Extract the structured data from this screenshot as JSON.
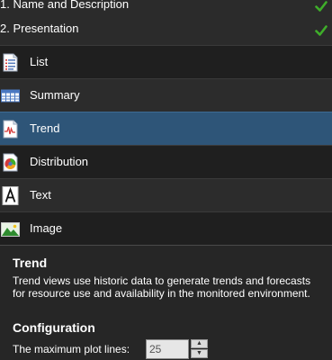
{
  "steps": [
    {
      "label": "1. Name and Description",
      "status": "complete",
      "icon": "check-icon"
    },
    {
      "label": "2. Presentation",
      "status": "complete",
      "icon": "check-icon"
    }
  ],
  "options": [
    {
      "label": "List",
      "icon": "list-icon",
      "selected": false
    },
    {
      "label": "Summary",
      "icon": "summary-grid-icon",
      "selected": false
    },
    {
      "label": "Trend",
      "icon": "trend-chart-icon",
      "selected": true
    },
    {
      "label": "Distribution",
      "icon": "pie-chart-icon",
      "selected": false
    },
    {
      "label": "Text",
      "icon": "text-icon",
      "selected": false
    },
    {
      "label": "Image",
      "icon": "image-icon",
      "selected": false
    }
  ],
  "details": {
    "title": "Trend",
    "description": "Trend views use historic data to generate trends and forecasts for resource use and availability in the monitored environment.",
    "config_title": "Configuration",
    "plot_lines_label": "The maximum plot lines:",
    "plot_lines_value": "25"
  },
  "colors": {
    "selected_bg": "#2e5578",
    "check_green": "#3fae2a"
  }
}
